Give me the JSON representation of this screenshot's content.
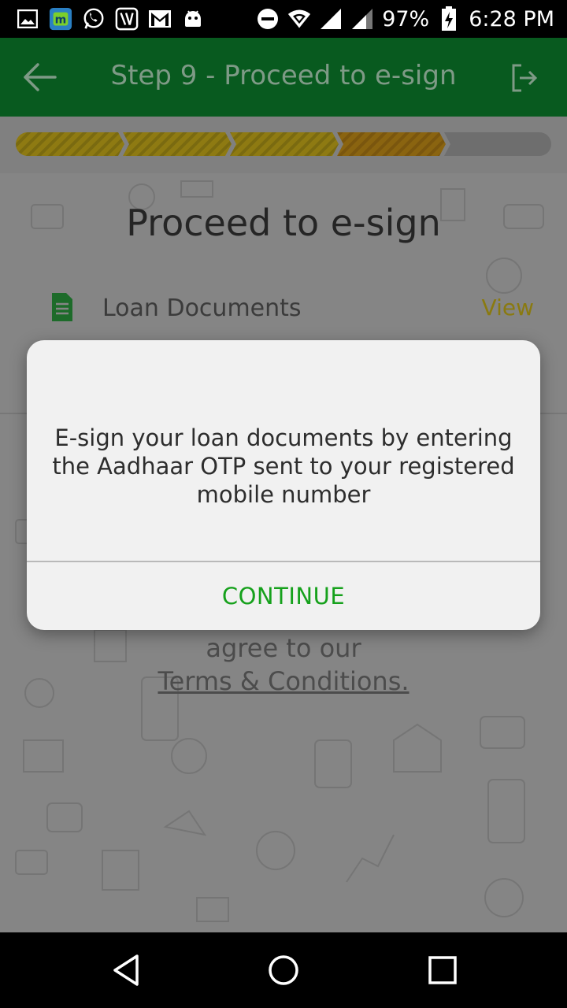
{
  "status_bar": {
    "battery": "97%",
    "time": "6:28 PM",
    "icons": [
      "gallery-icon",
      "app-m-icon",
      "whatsapp-icon",
      "saavn-icon",
      "gmail-icon",
      "android-icon",
      "dnd-icon",
      "wifi-icon",
      "signal-icon",
      "signal-icon-2",
      "battery-charging-icon"
    ]
  },
  "app_bar": {
    "title": "Step 9 - Proceed to e-sign",
    "back_icon": "back-arrow-icon",
    "logout_icon": "logout-icon",
    "color": "#085a1f"
  },
  "progress": {
    "total_steps": 5,
    "completed_steps": 3,
    "current_step": 4
  },
  "content": {
    "heading": "Proceed to e-sign",
    "document_label": "Loan Documents",
    "document_action": "View",
    "agree_text": "agree to our",
    "terms_text": "Terms & Conditions."
  },
  "dialog": {
    "message": "E-sign your loan documents by entering the Aadhaar OTP sent to your registered mobile number",
    "button_label": "CONTINUE",
    "button_color": "#16a11c"
  },
  "nav_bar": {
    "icons": [
      "back-triangle-icon",
      "home-circle-icon",
      "recents-square-icon"
    ]
  }
}
